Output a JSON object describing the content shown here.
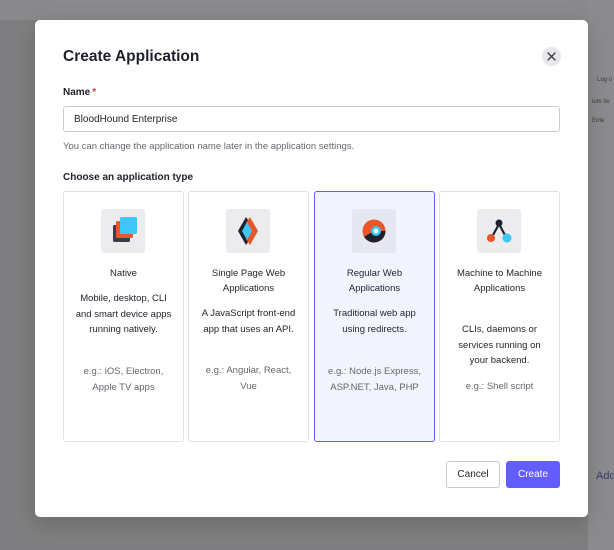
{
  "background": {
    "fragments": [
      "Log o",
      "ium ite",
      "Ente"
    ],
    "add_link": "Add"
  },
  "modal": {
    "title": "Create Application",
    "close_icon": "close-icon",
    "name_field": {
      "label": "Name",
      "required_marker": "*",
      "value": "BloodHound Enterprise",
      "helper": "You can change the application name later in the application settings."
    },
    "type_section": {
      "label": "Choose an application type",
      "selected": "regular-web",
      "cards": [
        {
          "id": "native",
          "icon": "native-app-icon",
          "title": "Native",
          "description": "Mobile, desktop, CLI and smart device apps running natively.",
          "example": "e.g.: iOS, Electron, Apple TV apps"
        },
        {
          "id": "spa",
          "icon": "spa-icon",
          "title": "Single Page Web Applications",
          "description": "A JavaScript front-end app that uses an API.",
          "example": "e.g.: Angular, React, Vue"
        },
        {
          "id": "regular-web",
          "icon": "regular-web-icon",
          "title": "Regular Web Applications",
          "description": "Traditional web app using redirects.",
          "example": "e.g.: Node.js Express, ASP.NET, Java, PHP"
        },
        {
          "id": "m2m",
          "icon": "machine-to-machine-icon",
          "title": "Machine to Machine Applications",
          "description": "CLIs, daemons or services running on your backend.",
          "example": "e.g.: Shell script"
        }
      ]
    },
    "buttons": {
      "cancel": "Cancel",
      "create": "Create"
    },
    "colors": {
      "accent": "#635dff",
      "required": "#d03c38"
    }
  }
}
